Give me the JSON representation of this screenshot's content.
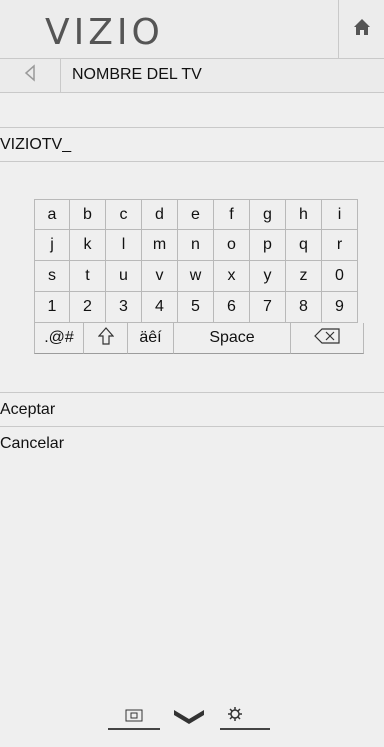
{
  "header": {
    "logo_text": "VIZIO",
    "home_icon": "home-icon"
  },
  "title_row": {
    "back_icon": "back-arrow-icon",
    "title": "NOMBRE DEL TV"
  },
  "input": {
    "value": "VIZIOTV_"
  },
  "keyboard": {
    "rows": [
      [
        "a",
        "b",
        "c",
        "d",
        "e",
        "f",
        "g",
        "h",
        "i"
      ],
      [
        "j",
        "k",
        "l",
        "m",
        "n",
        "o",
        "p",
        "q",
        "r"
      ],
      [
        "s",
        "t",
        "u",
        "v",
        "w",
        "x",
        "y",
        "z",
        "0"
      ],
      [
        "1",
        "2",
        "3",
        "4",
        "5",
        "6",
        "7",
        "8",
        "9"
      ]
    ],
    "symbols_label": ".@#",
    "shift_icon": "shift-icon",
    "accents_label": "äêí",
    "space_label": "Space",
    "backspace_icon": "backspace-icon"
  },
  "actions": {
    "accept": "Aceptar",
    "cancel": "Cancelar"
  },
  "bottom_bar": {
    "icons": [
      "input-icon",
      "vizio-v-icon",
      "settings-gear-icon"
    ]
  },
  "colors": {
    "background": "#efefef",
    "divider": "#c9c9c9",
    "text": "#111111",
    "logo": "#555555"
  }
}
